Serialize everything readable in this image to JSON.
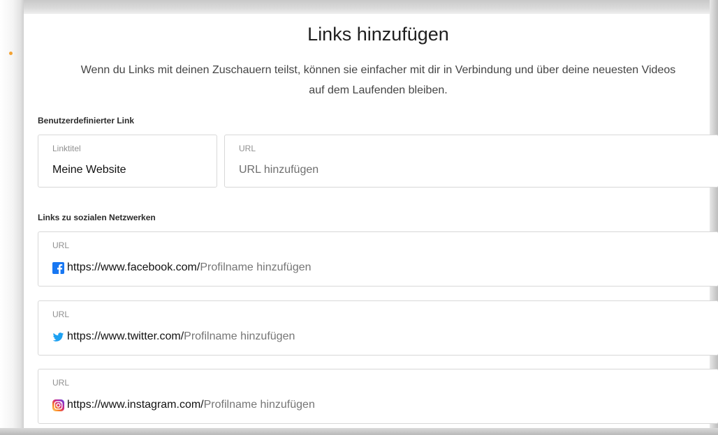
{
  "dialog": {
    "title": "Links hinzufügen",
    "description": "Wenn du Links mit deinen Zuschauern teilst, können sie einfacher mit dir in Verbindung und über deine neuesten Videos auf dem Laufenden bleiben."
  },
  "custom_link": {
    "section_label": "Benutzerdefinierter Link",
    "title_field": {
      "label": "Linktitel",
      "value": "Meine Website"
    },
    "url_field": {
      "label": "URL",
      "placeholder": "URL hinzufügen"
    }
  },
  "social_links": {
    "section_label": "Links zu sozialen Netzwerken",
    "items": [
      {
        "network": "facebook",
        "icon": "facebook-icon",
        "label": "URL",
        "prefix": "https://www.facebook.com/",
        "placeholder": "Profilname hinzufügen"
      },
      {
        "network": "twitter",
        "icon": "twitter-icon",
        "label": "URL",
        "prefix": "https://www.twitter.com/",
        "placeholder": "Profilname hinzufügen"
      },
      {
        "network": "instagram",
        "icon": "instagram-icon",
        "label": "URL",
        "prefix": "https://www.instagram.com/",
        "placeholder": "Profilname hinzufügen"
      }
    ]
  },
  "colors": {
    "facebook": "#1877f2",
    "twitter": "#1da1f2",
    "instagram_gradient": [
      "#feda75",
      "#fa7e1e",
      "#d62976",
      "#962fbf",
      "#4f5bd5"
    ],
    "border": "#d8d8d8",
    "accent_dot": "#f3a233"
  }
}
